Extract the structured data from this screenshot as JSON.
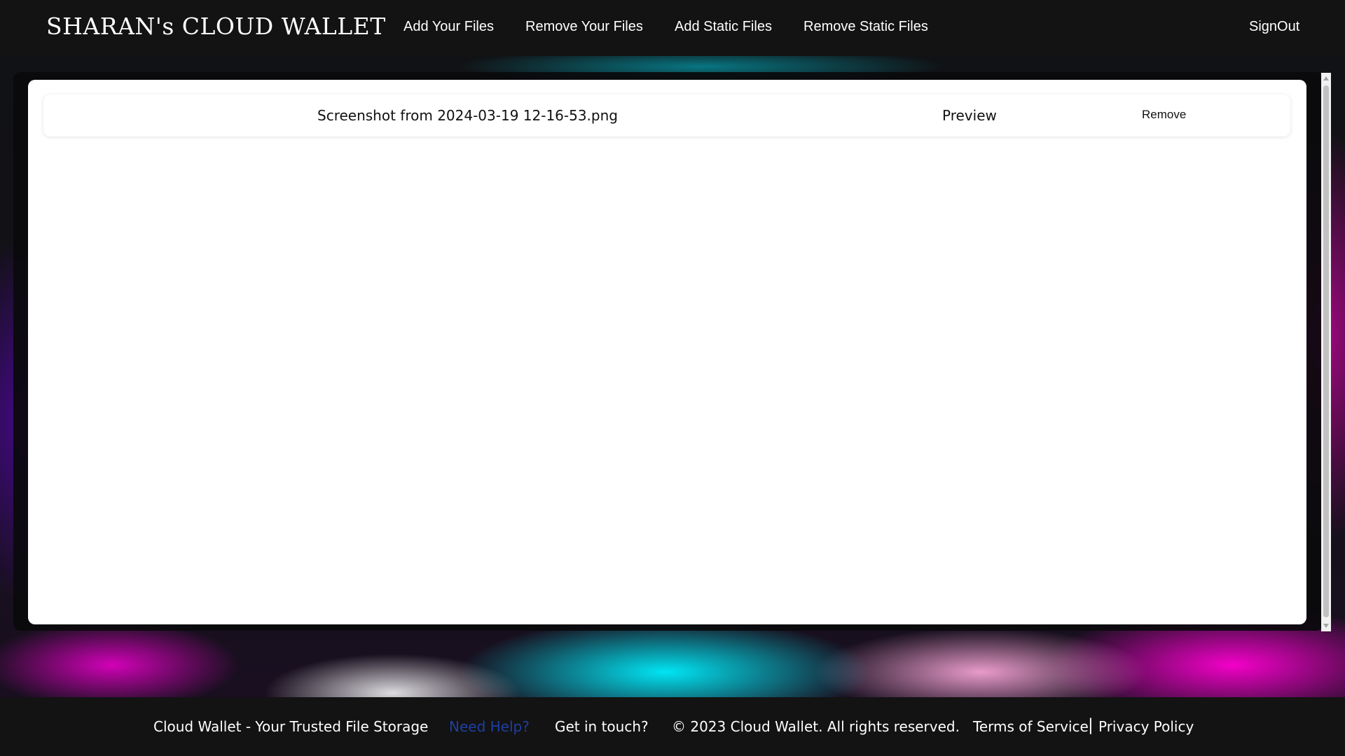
{
  "header": {
    "brand": "SHARAN's CLOUD WALLET",
    "nav": {
      "add_your_files": "Add Your Files",
      "remove_your_files": "Remove Your Files",
      "add_static_files": "Add Static Files",
      "remove_static_files": "Remove Static Files"
    },
    "signout": "SignOut"
  },
  "files": [
    {
      "name": "Screenshot from 2024-03-19 12-16-53.png",
      "preview_label": "Preview",
      "remove_label": "Remove"
    }
  ],
  "footer": {
    "tagline": "Cloud Wallet - Your Trusted File Storage",
    "help": "Need Help?",
    "get_in_touch": "Get in touch?",
    "copyright": "© 2023 Cloud Wallet. All rights reserved.",
    "terms": "Terms of Service",
    "separator": "|",
    "privacy": "Privacy Policy"
  },
  "colors": {
    "header_bg": "#131313",
    "footer_bg": "#131313",
    "help_link": "#1f3fa3",
    "card_bg": "#ffffff"
  }
}
